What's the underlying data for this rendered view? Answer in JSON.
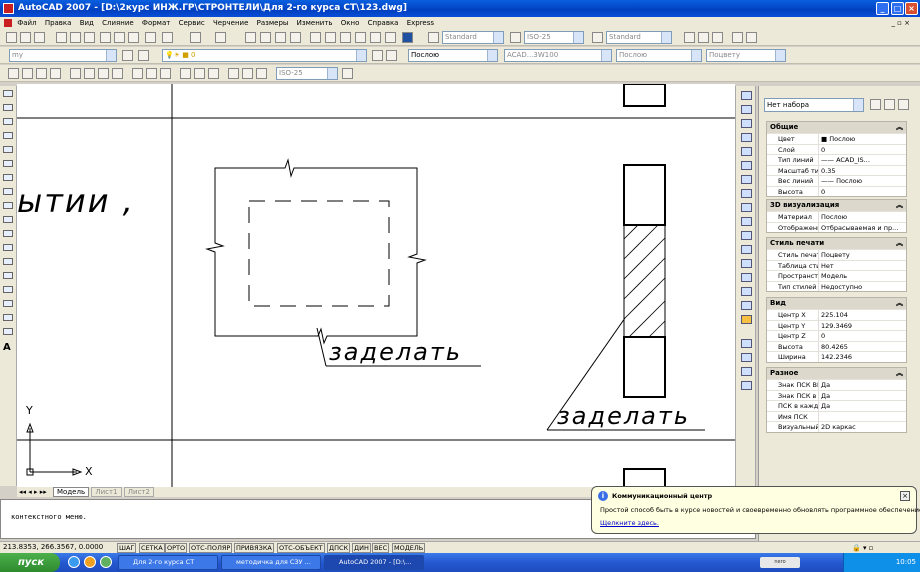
{
  "window": {
    "title": "AutoCAD 2007 - [D:\\2курс ИНЖ.ГР\\СТРОНТЕЛИ\\Для 2-го курса СТ\\123.dwg]"
  },
  "menu": [
    "Файл",
    "Правка",
    "Вид",
    "Слияние",
    "Формат",
    "Сервис",
    "Черчение",
    "Размеры",
    "Изменить",
    "Окно",
    "Справка",
    "Express"
  ],
  "toolbar": {
    "textstyle": "Standard",
    "dimstyle": "ISO-25",
    "tablestyle": "Standard",
    "layer": "my",
    "color": "Послою",
    "linetype": "ACAD...3W100",
    "lineweight": "Послою",
    "plotstyle": "Поцвету",
    "dimstyle2": "ISO-25"
  },
  "drawing": {
    "text1": "ытии ,",
    "text2": "заделать",
    "text3": "заделать",
    "ucs_x": "X",
    "ucs_y": "Y"
  },
  "tabs": [
    "Модель",
    "Лист1",
    "Лист2"
  ],
  "command": {
    "line": "контекстного меню."
  },
  "properties": {
    "selection": "Нет набора",
    "sections": [
      {
        "title": "Общие",
        "rows": [
          [
            "Цвет",
            "■ Послою"
          ],
          [
            "Слой",
            "0"
          ],
          [
            "Тип линий",
            "—— ACAD_IS..."
          ],
          [
            "Масштаб тип...",
            "0.35"
          ],
          [
            "Вес линий",
            "—— Послою"
          ],
          [
            "Высота",
            "0"
          ]
        ]
      },
      {
        "title": "3D визуализация",
        "rows": [
          [
            "Материал",
            "Послою"
          ],
          [
            "Отображени...",
            "Отбрасываемая и пр..."
          ]
        ]
      },
      {
        "title": "Стиль печати",
        "rows": [
          [
            "Стиль печати",
            "Поцвету"
          ],
          [
            "Таблица сти...",
            "Нет"
          ],
          [
            "Пространств...",
            "Модель"
          ],
          [
            "Тип стилей п...",
            "Недоступно"
          ]
        ]
      },
      {
        "title": "Вид",
        "rows": [
          [
            "Центр X",
            "225.104"
          ],
          [
            "Центр Y",
            "129.3469"
          ],
          [
            "Центр Z",
            "0"
          ],
          [
            "Высота",
            "80.4265"
          ],
          [
            "Ширина",
            "142.2346"
          ]
        ]
      },
      {
        "title": "Разное",
        "rows": [
          [
            "Знак ПСК ВКЛ",
            "Да"
          ],
          [
            "Знак ПСК в н...",
            "Да"
          ],
          [
            "ПСК в каждо...",
            "Да"
          ],
          [
            "Имя ПСК",
            ""
          ],
          [
            "Визуальный ...",
            "2D каркас"
          ]
        ]
      }
    ]
  },
  "status": {
    "coords": "213.8353, 266.3567, 0.0000",
    "buttons": [
      "ШАГ",
      "СЕТКА",
      "ОРТО",
      "ОТС-ПОЛЯР",
      "ПРИВЯЗКА",
      "ОТС-ОБЪЕКТ",
      "ДПСК",
      "ДИН",
      "ВЕС",
      "МОДЕЛЬ"
    ]
  },
  "balloon": {
    "title": "Коммуникационный центр",
    "body": "Простой способ быть в курсе новостей и своевременно обновлять программное обеспечение.",
    "link": "Щелкните здесь."
  },
  "taskbar": {
    "start": "пуск",
    "tasks": [
      "Для 2-го курса СТ",
      "методичка для СЗУ ...",
      "AutoCAD 2007 - [D:\\..."
    ],
    "clock": "10:05"
  }
}
